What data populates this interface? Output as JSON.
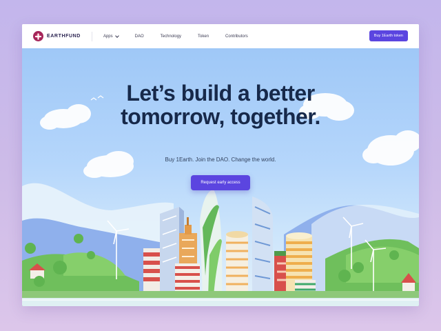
{
  "brand": {
    "name": "EARTHFUND",
    "accent": "#5b45e0"
  },
  "nav": {
    "items": [
      {
        "label": "Apps",
        "dropdown": true
      },
      {
        "label": "DAO"
      },
      {
        "label": "Technology"
      },
      {
        "label": "Token"
      },
      {
        "label": "Contributors"
      }
    ],
    "cta_label": "Buy 1Earth token"
  },
  "hero": {
    "headline_line1": "Let’s build a better",
    "headline_line2": "tomorrow, together.",
    "subtitle": "Buy 1Earth. Join the DAO. Change the world.",
    "cta_label": "Request early access"
  },
  "icons": [
    "earthfund-logo-icon",
    "chevron-down-icon"
  ]
}
